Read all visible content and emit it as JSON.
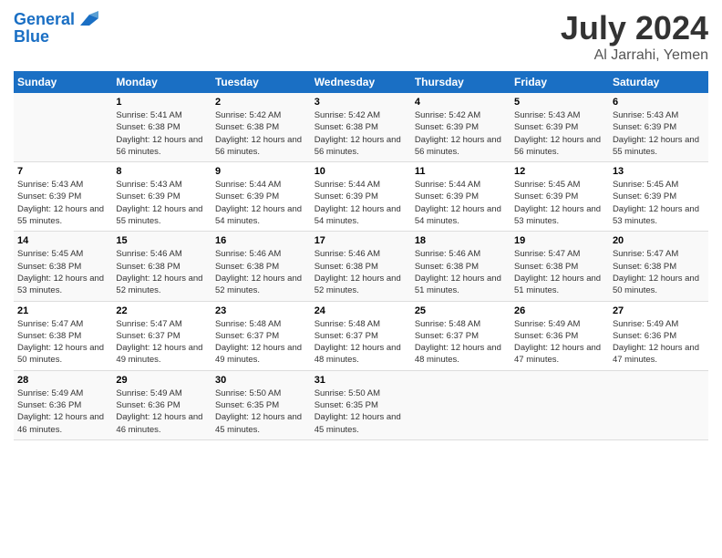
{
  "header": {
    "logo_line1": "General",
    "logo_line2": "Blue",
    "month": "July 2024",
    "location": "Al Jarrahi, Yemen"
  },
  "days_of_week": [
    "Sunday",
    "Monday",
    "Tuesday",
    "Wednesday",
    "Thursday",
    "Friday",
    "Saturday"
  ],
  "weeks": [
    [
      {
        "day": "",
        "sunrise": "",
        "sunset": "",
        "daylight": ""
      },
      {
        "day": "1",
        "sunrise": "Sunrise: 5:41 AM",
        "sunset": "Sunset: 6:38 PM",
        "daylight": "Daylight: 12 hours and 56 minutes."
      },
      {
        "day": "2",
        "sunrise": "Sunrise: 5:42 AM",
        "sunset": "Sunset: 6:38 PM",
        "daylight": "Daylight: 12 hours and 56 minutes."
      },
      {
        "day": "3",
        "sunrise": "Sunrise: 5:42 AM",
        "sunset": "Sunset: 6:38 PM",
        "daylight": "Daylight: 12 hours and 56 minutes."
      },
      {
        "day": "4",
        "sunrise": "Sunrise: 5:42 AM",
        "sunset": "Sunset: 6:39 PM",
        "daylight": "Daylight: 12 hours and 56 minutes."
      },
      {
        "day": "5",
        "sunrise": "Sunrise: 5:43 AM",
        "sunset": "Sunset: 6:39 PM",
        "daylight": "Daylight: 12 hours and 56 minutes."
      },
      {
        "day": "6",
        "sunrise": "Sunrise: 5:43 AM",
        "sunset": "Sunset: 6:39 PM",
        "daylight": "Daylight: 12 hours and 55 minutes."
      }
    ],
    [
      {
        "day": "7",
        "sunrise": "Sunrise: 5:43 AM",
        "sunset": "Sunset: 6:39 PM",
        "daylight": "Daylight: 12 hours and 55 minutes."
      },
      {
        "day": "8",
        "sunrise": "Sunrise: 5:43 AM",
        "sunset": "Sunset: 6:39 PM",
        "daylight": "Daylight: 12 hours and 55 minutes."
      },
      {
        "day": "9",
        "sunrise": "Sunrise: 5:44 AM",
        "sunset": "Sunset: 6:39 PM",
        "daylight": "Daylight: 12 hours and 54 minutes."
      },
      {
        "day": "10",
        "sunrise": "Sunrise: 5:44 AM",
        "sunset": "Sunset: 6:39 PM",
        "daylight": "Daylight: 12 hours and 54 minutes."
      },
      {
        "day": "11",
        "sunrise": "Sunrise: 5:44 AM",
        "sunset": "Sunset: 6:39 PM",
        "daylight": "Daylight: 12 hours and 54 minutes."
      },
      {
        "day": "12",
        "sunrise": "Sunrise: 5:45 AM",
        "sunset": "Sunset: 6:39 PM",
        "daylight": "Daylight: 12 hours and 53 minutes."
      },
      {
        "day": "13",
        "sunrise": "Sunrise: 5:45 AM",
        "sunset": "Sunset: 6:39 PM",
        "daylight": "Daylight: 12 hours and 53 minutes."
      }
    ],
    [
      {
        "day": "14",
        "sunrise": "Sunrise: 5:45 AM",
        "sunset": "Sunset: 6:38 PM",
        "daylight": "Daylight: 12 hours and 53 minutes."
      },
      {
        "day": "15",
        "sunrise": "Sunrise: 5:46 AM",
        "sunset": "Sunset: 6:38 PM",
        "daylight": "Daylight: 12 hours and 52 minutes."
      },
      {
        "day": "16",
        "sunrise": "Sunrise: 5:46 AM",
        "sunset": "Sunset: 6:38 PM",
        "daylight": "Daylight: 12 hours and 52 minutes."
      },
      {
        "day": "17",
        "sunrise": "Sunrise: 5:46 AM",
        "sunset": "Sunset: 6:38 PM",
        "daylight": "Daylight: 12 hours and 52 minutes."
      },
      {
        "day": "18",
        "sunrise": "Sunrise: 5:46 AM",
        "sunset": "Sunset: 6:38 PM",
        "daylight": "Daylight: 12 hours and 51 minutes."
      },
      {
        "day": "19",
        "sunrise": "Sunrise: 5:47 AM",
        "sunset": "Sunset: 6:38 PM",
        "daylight": "Daylight: 12 hours and 51 minutes."
      },
      {
        "day": "20",
        "sunrise": "Sunrise: 5:47 AM",
        "sunset": "Sunset: 6:38 PM",
        "daylight": "Daylight: 12 hours and 50 minutes."
      }
    ],
    [
      {
        "day": "21",
        "sunrise": "Sunrise: 5:47 AM",
        "sunset": "Sunset: 6:38 PM",
        "daylight": "Daylight: 12 hours and 50 minutes."
      },
      {
        "day": "22",
        "sunrise": "Sunrise: 5:47 AM",
        "sunset": "Sunset: 6:37 PM",
        "daylight": "Daylight: 12 hours and 49 minutes."
      },
      {
        "day": "23",
        "sunrise": "Sunrise: 5:48 AM",
        "sunset": "Sunset: 6:37 PM",
        "daylight": "Daylight: 12 hours and 49 minutes."
      },
      {
        "day": "24",
        "sunrise": "Sunrise: 5:48 AM",
        "sunset": "Sunset: 6:37 PM",
        "daylight": "Daylight: 12 hours and 48 minutes."
      },
      {
        "day": "25",
        "sunrise": "Sunrise: 5:48 AM",
        "sunset": "Sunset: 6:37 PM",
        "daylight": "Daylight: 12 hours and 48 minutes."
      },
      {
        "day": "26",
        "sunrise": "Sunrise: 5:49 AM",
        "sunset": "Sunset: 6:36 PM",
        "daylight": "Daylight: 12 hours and 47 minutes."
      },
      {
        "day": "27",
        "sunrise": "Sunrise: 5:49 AM",
        "sunset": "Sunset: 6:36 PM",
        "daylight": "Daylight: 12 hours and 47 minutes."
      }
    ],
    [
      {
        "day": "28",
        "sunrise": "Sunrise: 5:49 AM",
        "sunset": "Sunset: 6:36 PM",
        "daylight": "Daylight: 12 hours and 46 minutes."
      },
      {
        "day": "29",
        "sunrise": "Sunrise: 5:49 AM",
        "sunset": "Sunset: 6:36 PM",
        "daylight": "Daylight: 12 hours and 46 minutes."
      },
      {
        "day": "30",
        "sunrise": "Sunrise: 5:50 AM",
        "sunset": "Sunset: 6:35 PM",
        "daylight": "Daylight: 12 hours and 45 minutes."
      },
      {
        "day": "31",
        "sunrise": "Sunrise: 5:50 AM",
        "sunset": "Sunset: 6:35 PM",
        "daylight": "Daylight: 12 hours and 45 minutes."
      },
      {
        "day": "",
        "sunrise": "",
        "sunset": "",
        "daylight": ""
      },
      {
        "day": "",
        "sunrise": "",
        "sunset": "",
        "daylight": ""
      },
      {
        "day": "",
        "sunrise": "",
        "sunset": "",
        "daylight": ""
      }
    ]
  ]
}
